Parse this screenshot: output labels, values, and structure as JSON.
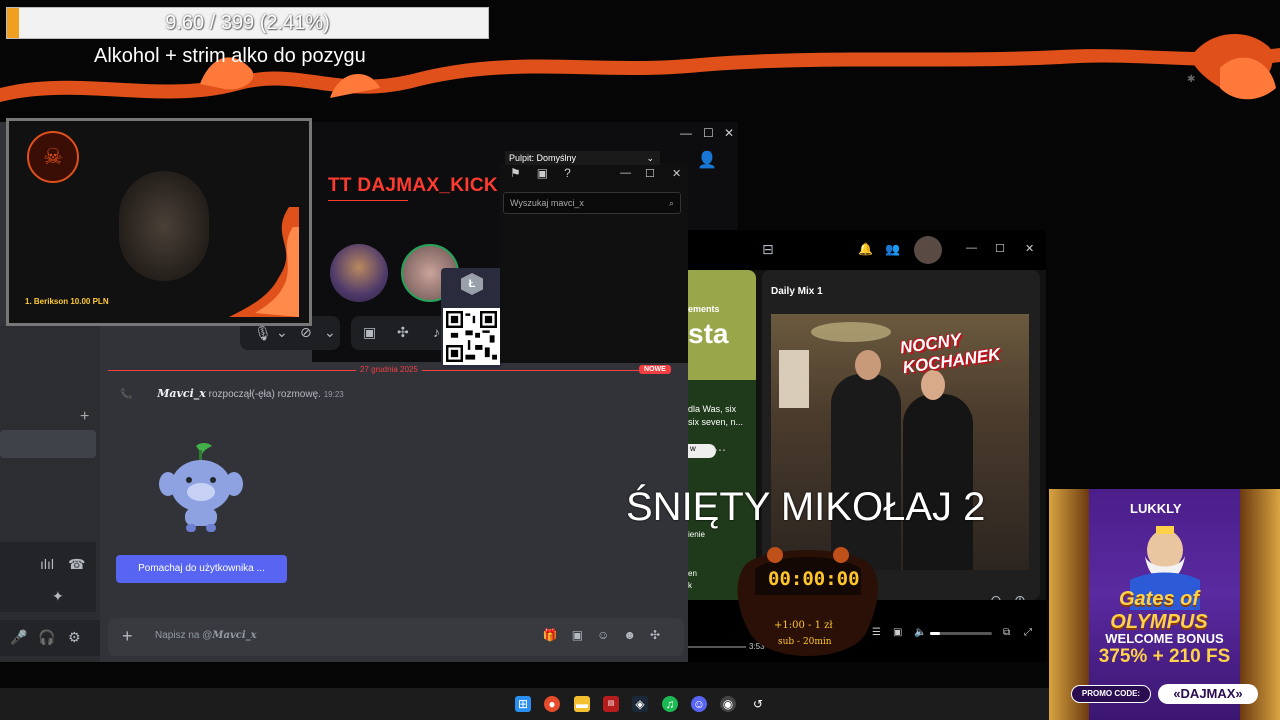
{
  "stream": {
    "goal": {
      "text": "9.60 / 399 (2.41%)",
      "progress_fraction": 0.0241,
      "title": "Alkohol + strim alko do pozygu"
    },
    "webcam": {
      "donor": "1. Berikson  10.00 PLN"
    },
    "overlay_text": "ŚNIĘTY MIKOŁAJ 2",
    "timer": {
      "value": "00:00:00",
      "line1": "+1:00 - 1 zł",
      "line2": "sub - 20min"
    }
  },
  "discord": {
    "call_title": "TT DAJMAX_KICK",
    "date_divider": "27 grudnia 2025",
    "new_badge": "NOWE",
    "message": {
      "user": "Mavci_x",
      "text": "rozpoczął(-ęła) rozmowę.",
      "time": "19:23"
    },
    "wave_button": "Pomachaj do użytkownika ...",
    "input": {
      "placeholder_prefix": "Napisz na @",
      "placeholder_user": "Mavci_x"
    },
    "hangup_icon": "phone-hangup-icon"
  },
  "obs": {
    "scene_select": "Pulpit: Domyślny",
    "search_placeholder": "Wyszukaj mavci_x"
  },
  "spotify": {
    "comments_label": "ements",
    "big_label": "sta",
    "desc": [
      "dla Was, six",
      "six seven, n..."
    ],
    "play_short": "w",
    "side_label1": "ienie",
    "side_label2": [
      "en",
      "k"
    ],
    "daily_mix_title": "Daily Mix 1",
    "cover_title": "NOCNY KOCHANEK",
    "time_elapsed": "3:53"
  },
  "ad": {
    "brand": "LUKKLY",
    "game": "Gates of OLYMPUS",
    "welcome": "WELCOME BONUS",
    "bonus": "375% + 210 FS",
    "promo_label": "PROMO CODE:",
    "promo_code": "«DAJMAX»"
  },
  "colors": {
    "discord_bg": "#313338",
    "discord_accent": "#5865f2",
    "hangup_red": "#da373c",
    "flame_orange": "#e0501a",
    "timer_gold": "#ffc629",
    "ad_purple": "#4b1e8a"
  }
}
